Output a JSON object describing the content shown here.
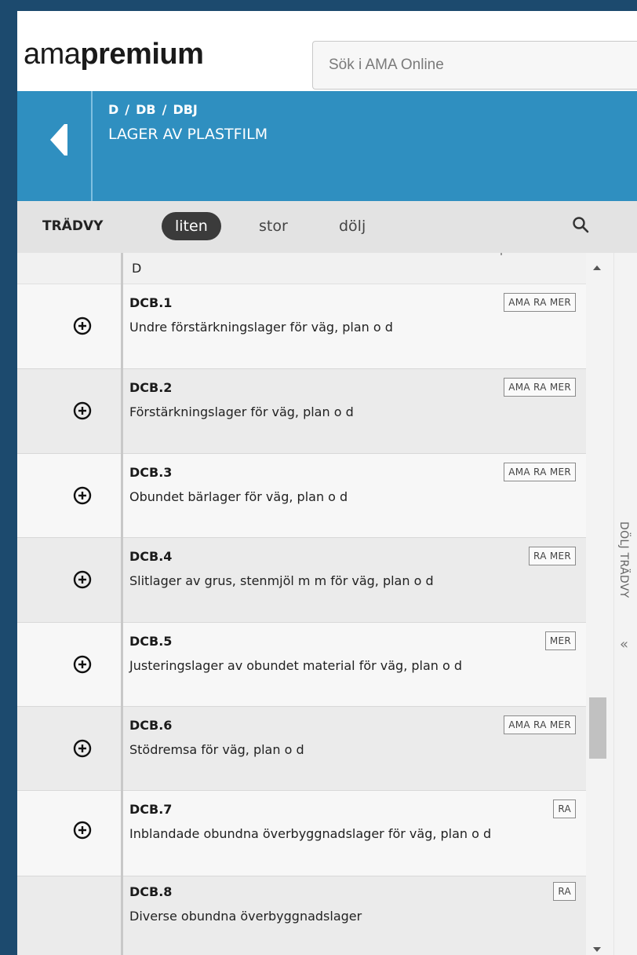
{
  "header": {
    "logo_light": "ama",
    "logo_bold": "premium",
    "search_placeholder": "Sök i AMA Online"
  },
  "breadcrumb": {
    "items": [
      "D",
      "DB",
      "DBJ"
    ],
    "separator": "/",
    "title": "LAGER AV PLASTFILM"
  },
  "tree_toolbar": {
    "label": "TRÄDVY",
    "sizes": [
      "liten",
      "stor",
      "dölj"
    ],
    "active_size": "liten"
  },
  "tree": {
    "root": "D",
    "rows": [
      {
        "code": "DCB.1",
        "desc": "Undre förstärkningslager för väg, plan o d",
        "tags": "AMA RA MER",
        "expandable": true
      },
      {
        "code": "DCB.2",
        "desc": "Förstärkningslager för väg, plan o d",
        "tags": "AMA RA MER",
        "expandable": true
      },
      {
        "code": "DCB.3",
        "desc": "Obundet bärlager för väg, plan o d",
        "tags": "AMA RA MER",
        "expandable": true
      },
      {
        "code": "DCB.4",
        "desc": "Slitlager av grus, stenmjöl m m för väg, plan o d",
        "tags": "RA MER",
        "expandable": true
      },
      {
        "code": "DCB.5",
        "desc": "Justeringslager av obundet material för väg, plan o d",
        "tags": "MER",
        "expandable": true
      },
      {
        "code": "DCB.6",
        "desc": "Stödremsa för väg, plan o d",
        "tags": "AMA RA MER",
        "expandable": true
      },
      {
        "code": "DCB.7",
        "desc": "Inblandade obundna överbyggnadslager för väg, plan o d",
        "tags": "RA",
        "expandable": true
      },
      {
        "code": "DCB.8",
        "desc": "Diverse obundna överbyggnadslager",
        "tags": "RA",
        "expandable": false
      }
    ]
  },
  "collapse_panel": {
    "label": "DÖLJ TRÄDVY",
    "chevron": "«"
  },
  "colors": {
    "page_border": "#1c4a6e",
    "banner": "#2f8fc0",
    "toolbar": "#e3e3e3",
    "pill": "#3b3b3b"
  }
}
